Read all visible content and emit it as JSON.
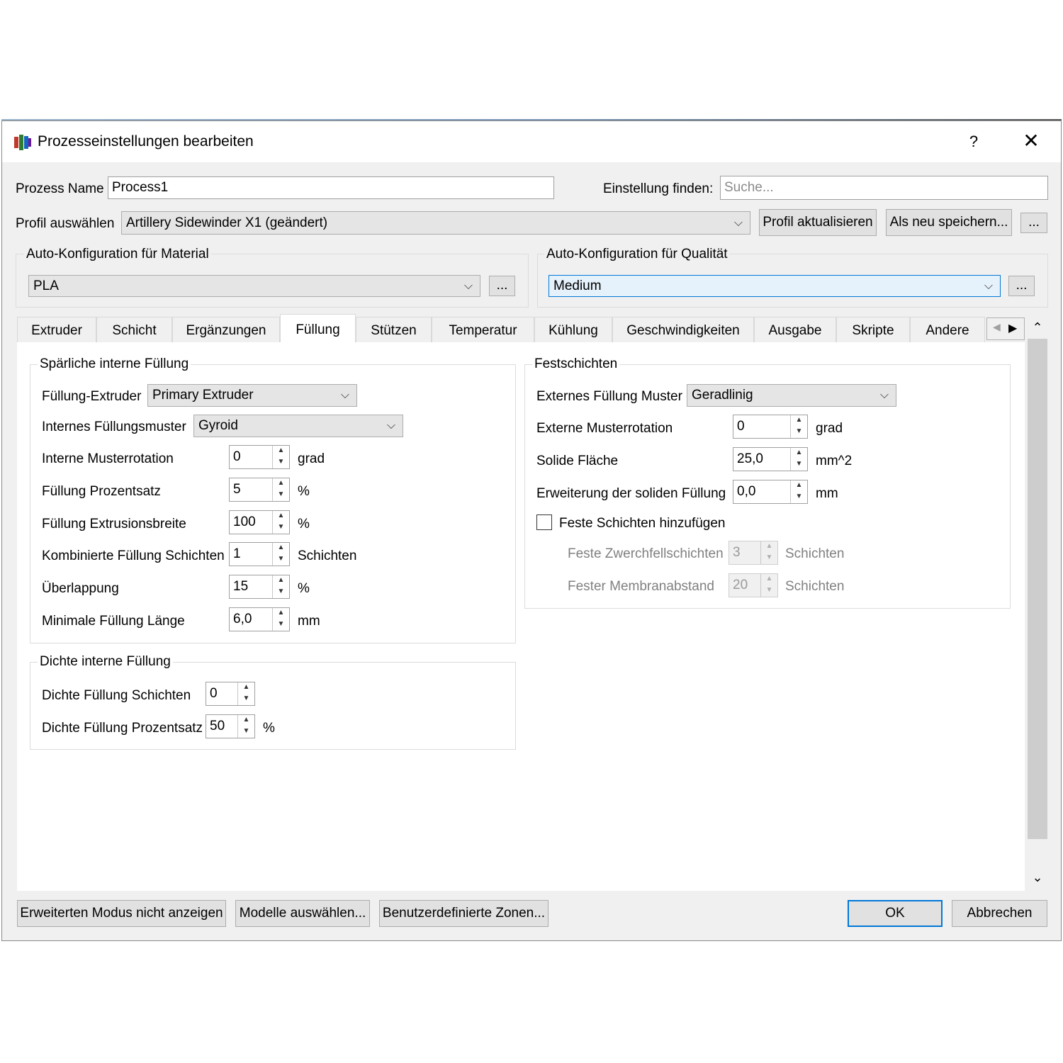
{
  "window": {
    "title": "Prozesseinstellungen bearbeiten",
    "help": "?",
    "close": "✕"
  },
  "process": {
    "name_label": "Prozess Name",
    "name_value": "Process1",
    "find_label": "Einstellung finden:",
    "find_placeholder": "Suche..."
  },
  "profile": {
    "label": "Profil auswählen",
    "value": "Artillery Sidewinder X1 (geändert)",
    "update_button": "Profil aktualisieren",
    "save_new_button": "Als neu speichern...",
    "more_button": "..."
  },
  "material": {
    "title": "Auto-Konfiguration für Material",
    "value": "PLA",
    "more_button": "..."
  },
  "quality": {
    "title": "Auto-Konfiguration für Qualität",
    "value": "Medium",
    "more_button": "..."
  },
  "tabs": [
    "Extruder",
    "Schicht",
    "Ergänzungen",
    "Füllung",
    "Stützen",
    "Temperatur",
    "Kühlung",
    "Geschwindigkeiten",
    "Ausgabe",
    "Skripte",
    "Andere"
  ],
  "selected_tab": "Füllung",
  "sparse": {
    "title": "Spärliche interne Füllung",
    "extruder_label": "Füllung-Extruder",
    "extruder_value": "Primary Extruder",
    "pattern_label": "Internes Füllungsmuster",
    "pattern_value": "Gyroid",
    "rotation_label": "Interne Musterrotation",
    "rotation_value": "0",
    "rotation_unit": "grad",
    "percent_label": "Füllung Prozentsatz",
    "percent_value": "5",
    "percent_unit": "%",
    "width_label": "Füllung Extrusionsbreite",
    "width_value": "100",
    "width_unit": "%",
    "combined_label": "Kombinierte Füllung Schichten",
    "combined_value": "1",
    "combined_unit": "Schichten",
    "overlap_label": "Überlappung",
    "overlap_value": "15",
    "overlap_unit": "%",
    "minlen_label": "Minimale Füllung Länge",
    "minlen_value": "6,0",
    "minlen_unit": "mm"
  },
  "dense": {
    "title": "Dichte interne Füllung",
    "layers_label": "Dichte Füllung Schichten",
    "layers_value": "0",
    "percent_label": "Dichte Füllung Prozentsatz",
    "percent_value": "50",
    "percent_unit": "%"
  },
  "solid": {
    "title": "Festschichten",
    "pattern_label": "Externes Füllung Muster",
    "pattern_value": "Geradlinig",
    "rotation_label": "Externe Musterrotation",
    "rotation_value": "0",
    "rotation_unit": "grad",
    "area_label": "Solide Fläche",
    "area_value": "25,0",
    "area_unit": "mm^2",
    "expand_label": "Erweiterung der soliden Füllung",
    "expand_value": "0,0",
    "expand_unit": "mm",
    "add_label": "Feste Schichten hinzufügen",
    "add_checked": false,
    "diaphragm_label": "Feste Zwerchfellschichten",
    "diaphragm_value": "3",
    "diaphragm_unit": "Schichten",
    "membrane_label": "Fester Membranabstand",
    "membrane_value": "20",
    "membrane_unit": "Schichten"
  },
  "footer": {
    "advanced_button": "Erweiterten Modus nicht anzeigen",
    "models_button": "Modelle auswählen...",
    "zones_button": "Benutzerdefinierte Zonen...",
    "ok_button": "OK",
    "cancel_button": "Abbrechen"
  },
  "colors": {
    "accent": "#0078d7",
    "dialog_bg": "#f0f0f0",
    "panel_bg": "#ffffff"
  },
  "icons": [
    "app-icon",
    "help-icon",
    "close-icon",
    "chevron-down-icon",
    "spin-up-icon",
    "spin-down-icon",
    "scroll-up-icon",
    "scroll-down-icon",
    "tab-scroll-left-icon",
    "tab-scroll-right-icon"
  ]
}
